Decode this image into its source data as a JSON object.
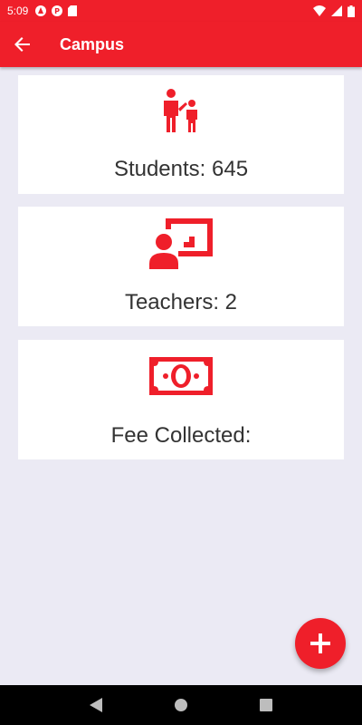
{
  "status_bar": {
    "time": "5:09",
    "icons_left": [
      "autofill-icon",
      "pocket-icon",
      "sd-card-icon"
    ],
    "icons_right": [
      "wifi-icon",
      "signal-icon",
      "battery-icon"
    ]
  },
  "app_bar": {
    "title": "Campus",
    "back_icon": "arrow-left-icon"
  },
  "cards": [
    {
      "icon": "parent-child-icon",
      "label": "Students: 645"
    },
    {
      "icon": "teacher-board-icon",
      "label": "Teachers: 2"
    },
    {
      "icon": "money-icon",
      "label": "Fee Collected:"
    }
  ],
  "fab": {
    "icon": "plus-icon"
  },
  "colors": {
    "primary": "#ef1f2a",
    "background": "#ebeaf4",
    "card": "#ffffff",
    "text": "#333333"
  },
  "nav_bar": {
    "icons": [
      "back-triangle-icon",
      "home-circle-icon",
      "recents-square-icon"
    ]
  }
}
